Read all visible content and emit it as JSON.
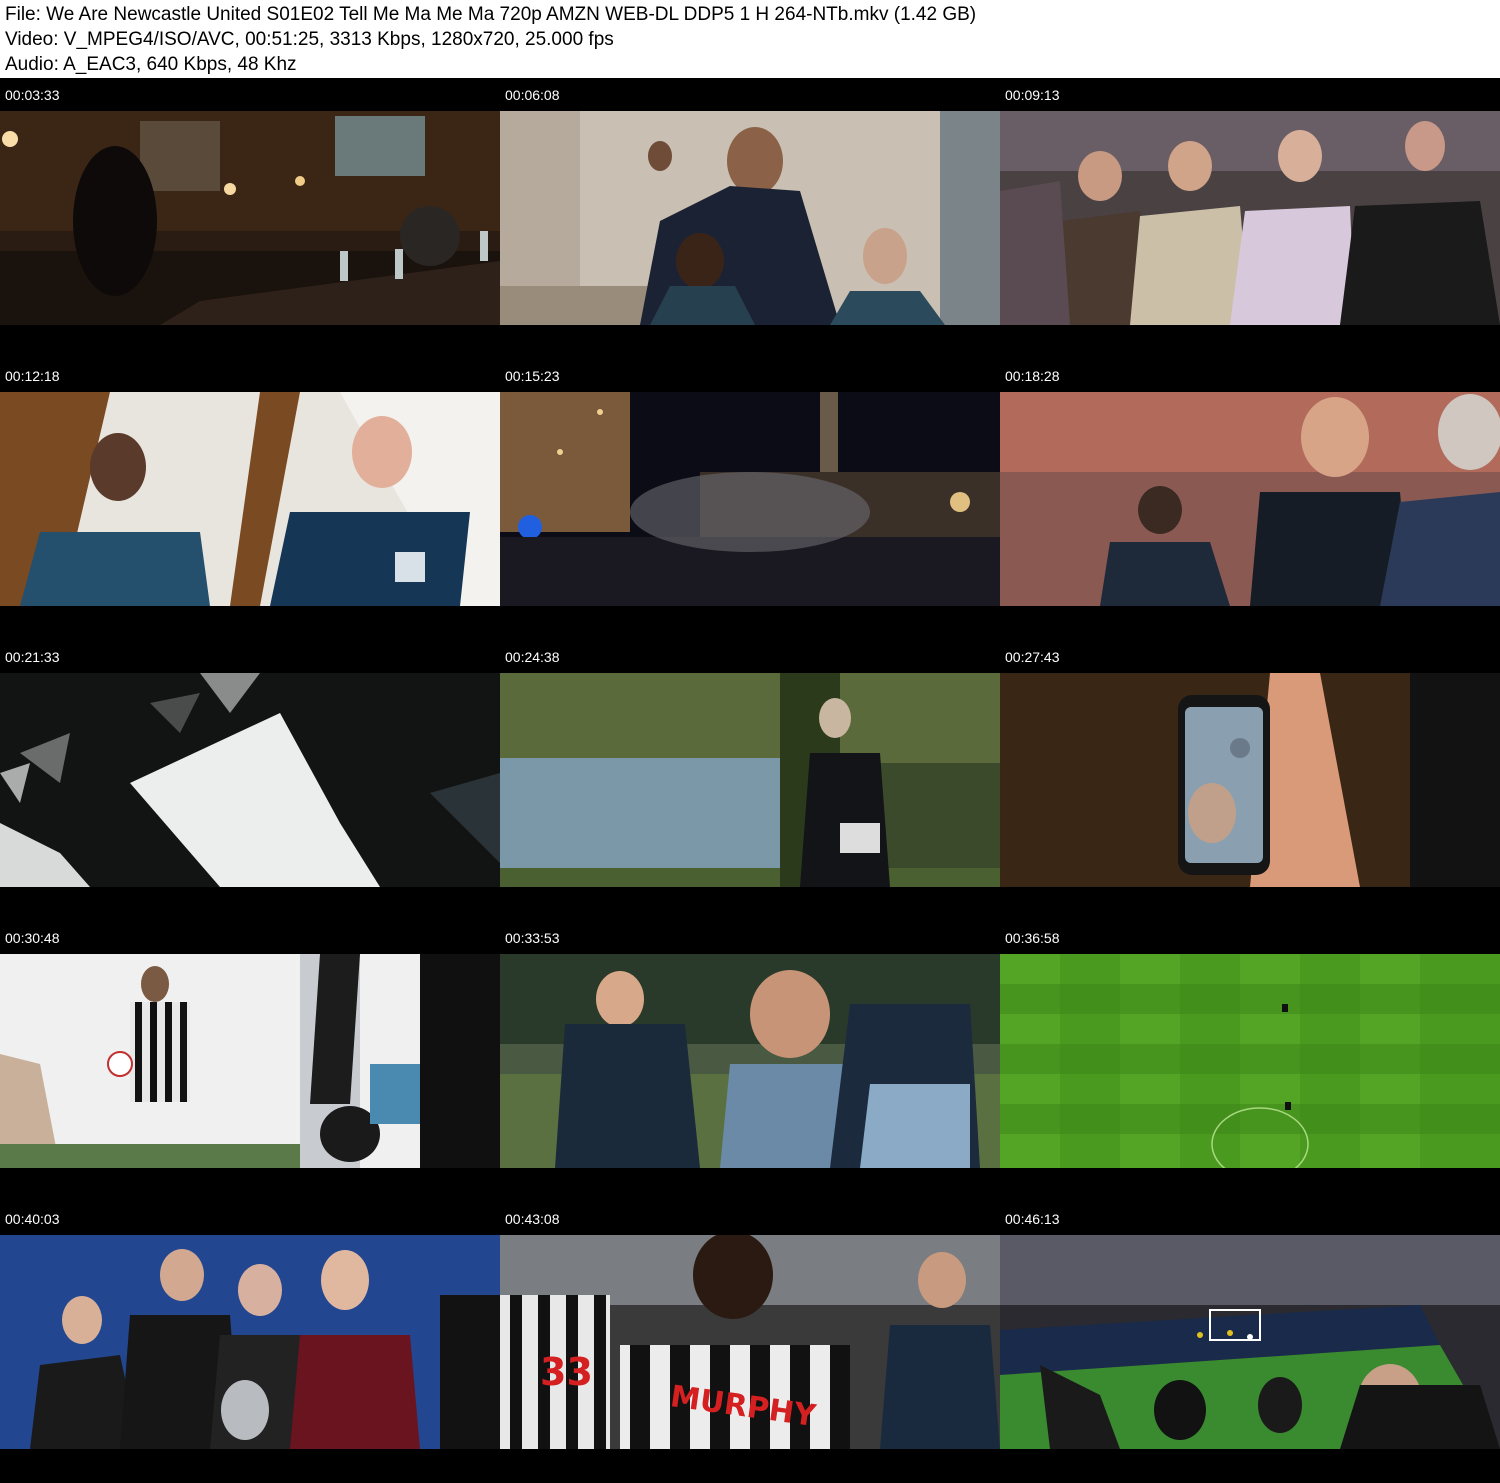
{
  "header": {
    "file_line": "File: We Are Newcastle United S01E02 Tell Me Ma Me Ma 720p AMZN WEB-DL DDP5 1 H 264-NTb.mkv (1.42 GB)",
    "video_line": "Video: V_MPEG4/ISO/AVC, 00:51:25, 3313 Kbps, 1280x720, 25.000 fps",
    "audio_line": "Audio: A_EAC3, 640 Kbps, 48 Khz"
  },
  "thumbnails": [
    {
      "timestamp": "00:03:33"
    },
    {
      "timestamp": "00:06:08"
    },
    {
      "timestamp": "00:09:13"
    },
    {
      "timestamp": "00:12:18"
    },
    {
      "timestamp": "00:15:23"
    },
    {
      "timestamp": "00:18:28"
    },
    {
      "timestamp": "00:21:33"
    },
    {
      "timestamp": "00:24:38"
    },
    {
      "timestamp": "00:27:43"
    },
    {
      "timestamp": "00:30:48"
    },
    {
      "timestamp": "00:33:53"
    },
    {
      "timestamp": "00:36:58"
    },
    {
      "timestamp": "00:40:03"
    },
    {
      "timestamp": "00:43:08"
    },
    {
      "timestamp": "00:46:13"
    }
  ],
  "frame_text": {
    "jersey_number": "33",
    "jersey_name": "MURPHY"
  },
  "colors": {
    "header_bg": "#ffffff",
    "page_bg": "#000000",
    "timestamp_text": "#ffffff"
  }
}
